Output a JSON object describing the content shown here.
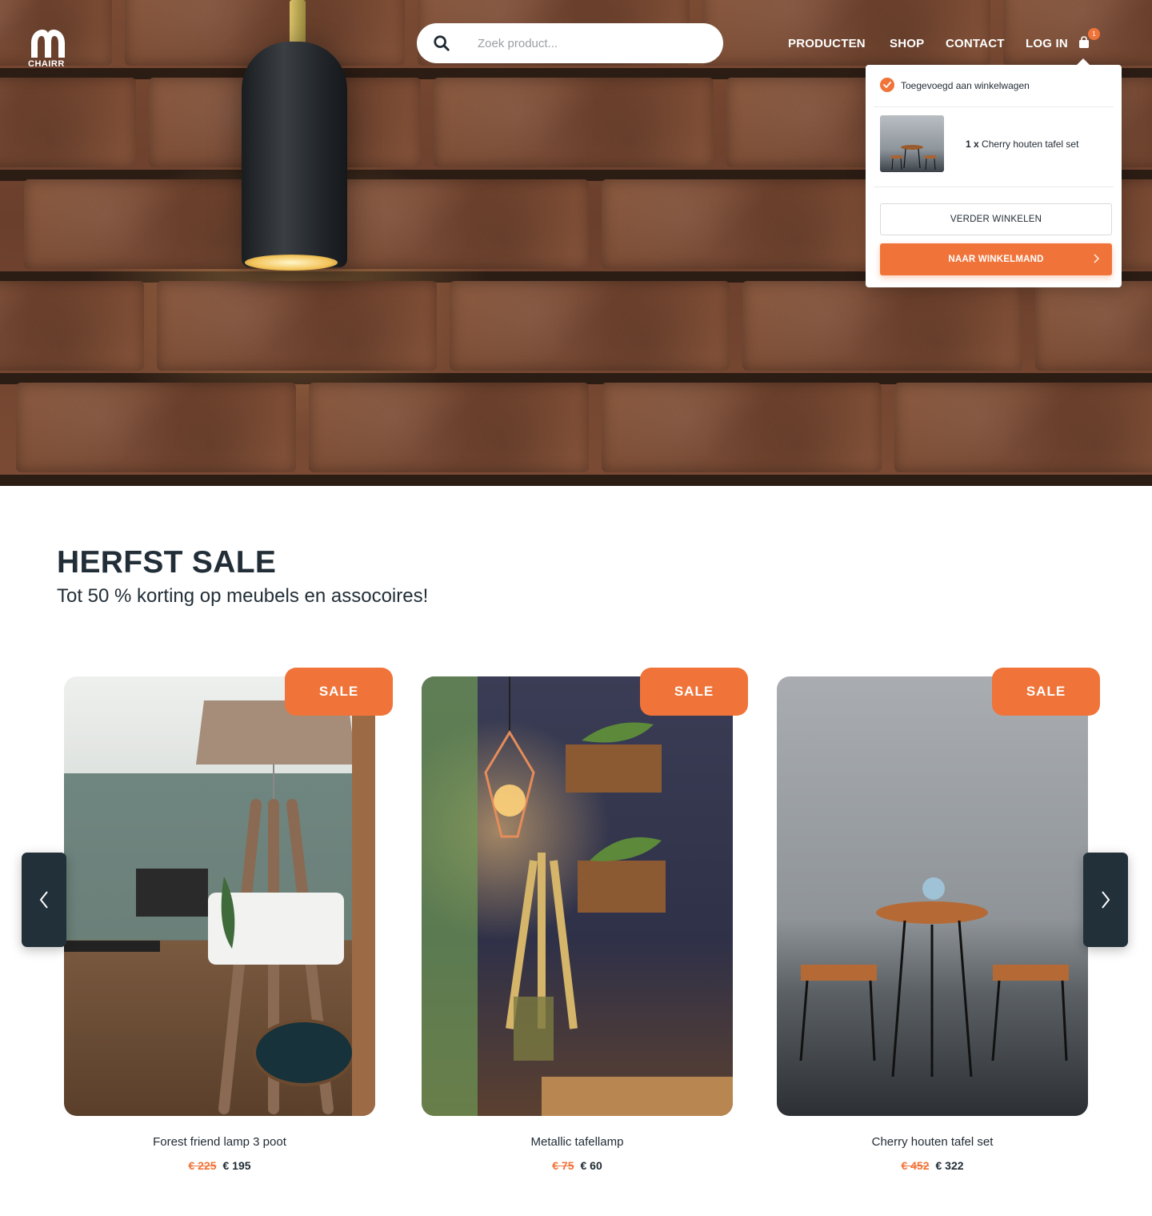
{
  "brand": {
    "name": "CHAIRR"
  },
  "search": {
    "placeholder": "Zoek product..."
  },
  "nav": {
    "items": [
      "PRODUCTEN",
      "SHOP",
      "CONTACT",
      "LOG IN"
    ]
  },
  "cart": {
    "count": "1"
  },
  "cart_popup": {
    "added_message": "Toegevoegd aan winkelwagen",
    "item_qty": "1 x",
    "item_name": "Cherry houten tafel set",
    "continue_label": "VERDER WINKELEN",
    "checkout_label": "NAAR WINKELMAND"
  },
  "sale": {
    "title": "HERFST SALE",
    "subtitle": "Tot 50 % korting op meubels en assocoires!"
  },
  "products": [
    {
      "badge": "SALE",
      "name": "Forest friend lamp 3 poot",
      "old_price": "€ 225",
      "new_price": "€ 195"
    },
    {
      "badge": "SALE",
      "name": "Metallic tafellamp",
      "old_price": "€ 75",
      "new_price": "€ 60"
    },
    {
      "badge": "SALE",
      "name": "Cherry houten tafel set",
      "old_price": "€ 452",
      "new_price": "€ 322"
    }
  ],
  "colors": {
    "accent": "#f0743a",
    "dark": "#22303a",
    "text": "#1f2a33"
  },
  "icons": [
    "logo-icon",
    "search-icon",
    "cart-icon",
    "check-icon",
    "chevron-right-icon",
    "chevron-left-icon"
  ]
}
